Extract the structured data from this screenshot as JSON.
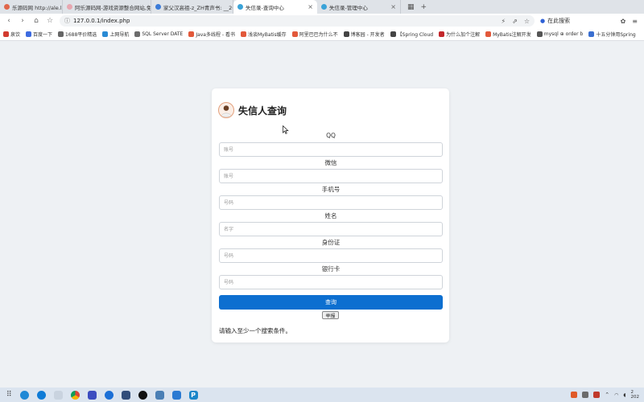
{
  "browser": {
    "tabs": [
      {
        "label": "乐源码网 http://ale.leleyangyu",
        "color": "#e0664a",
        "active": false
      },
      {
        "label": "阿乐源码网-游戏资源整合网站,免",
        "color": "#e8a7b0",
        "active": false
      },
      {
        "label": "家父汉高祖-z_ZH青声书: __2(",
        "color": "#3b7bd8",
        "active": false
      },
      {
        "label": "失信录-查询中心",
        "color": "#3aa3d8",
        "active": true
      },
      {
        "label": "失信录-管理中心",
        "color": "#3aa3d8",
        "active": false
      }
    ],
    "new_tab_glyph": "+",
    "url": "127.0.0.1/index.php",
    "search_chip": "在此搜索",
    "bookmarks": [
      {
        "label": "泉饮",
        "color": "#d23b2f"
      },
      {
        "label": "百度一下",
        "color": "#3d6be0"
      },
      {
        "label": "1688平价精选",
        "color": "#666666"
      },
      {
        "label": "上网导航",
        "color": "#2a8ad4"
      },
      {
        "label": "SQL Server DATE",
        "color": "#6c6c6c"
      },
      {
        "label": "Java多线程 - 看书",
        "color": "#e2593b"
      },
      {
        "label": "浅谈MyBatis缓存",
        "color": "#e2593b"
      },
      {
        "label": "阿里巴巴为什么不",
        "color": "#e2593b"
      },
      {
        "label": "博客园 - 开发者",
        "color": "#444444"
      },
      {
        "label": "【Spring Cloud",
        "color": "#444444"
      },
      {
        "label": "为什么加个注解",
        "color": "#c3272b"
      },
      {
        "label": "MyBatis注解开发",
        "color": "#e2593b"
      },
      {
        "label": "mysql ⊕ order b",
        "color": "#555555"
      },
      {
        "label": "十五分钟用Spring",
        "color": "#3a6fd0"
      }
    ]
  },
  "page": {
    "title": "失信人查询",
    "fields": [
      {
        "label": "QQ",
        "placeholder": "账号"
      },
      {
        "label": "微信",
        "placeholder": "账号"
      },
      {
        "label": "手机号",
        "placeholder": "号码"
      },
      {
        "label": "姓名",
        "placeholder": "名字"
      },
      {
        "label": "身份证",
        "placeholder": "号码"
      },
      {
        "label": "银行卡",
        "placeholder": "号码"
      }
    ],
    "query_button": "查询",
    "report_button": "举报",
    "message": "请输入至少一个搜索条件。",
    "accent_color": "#0d6fd0"
  },
  "taskbar": {
    "clock_partial": "2\n202"
  }
}
